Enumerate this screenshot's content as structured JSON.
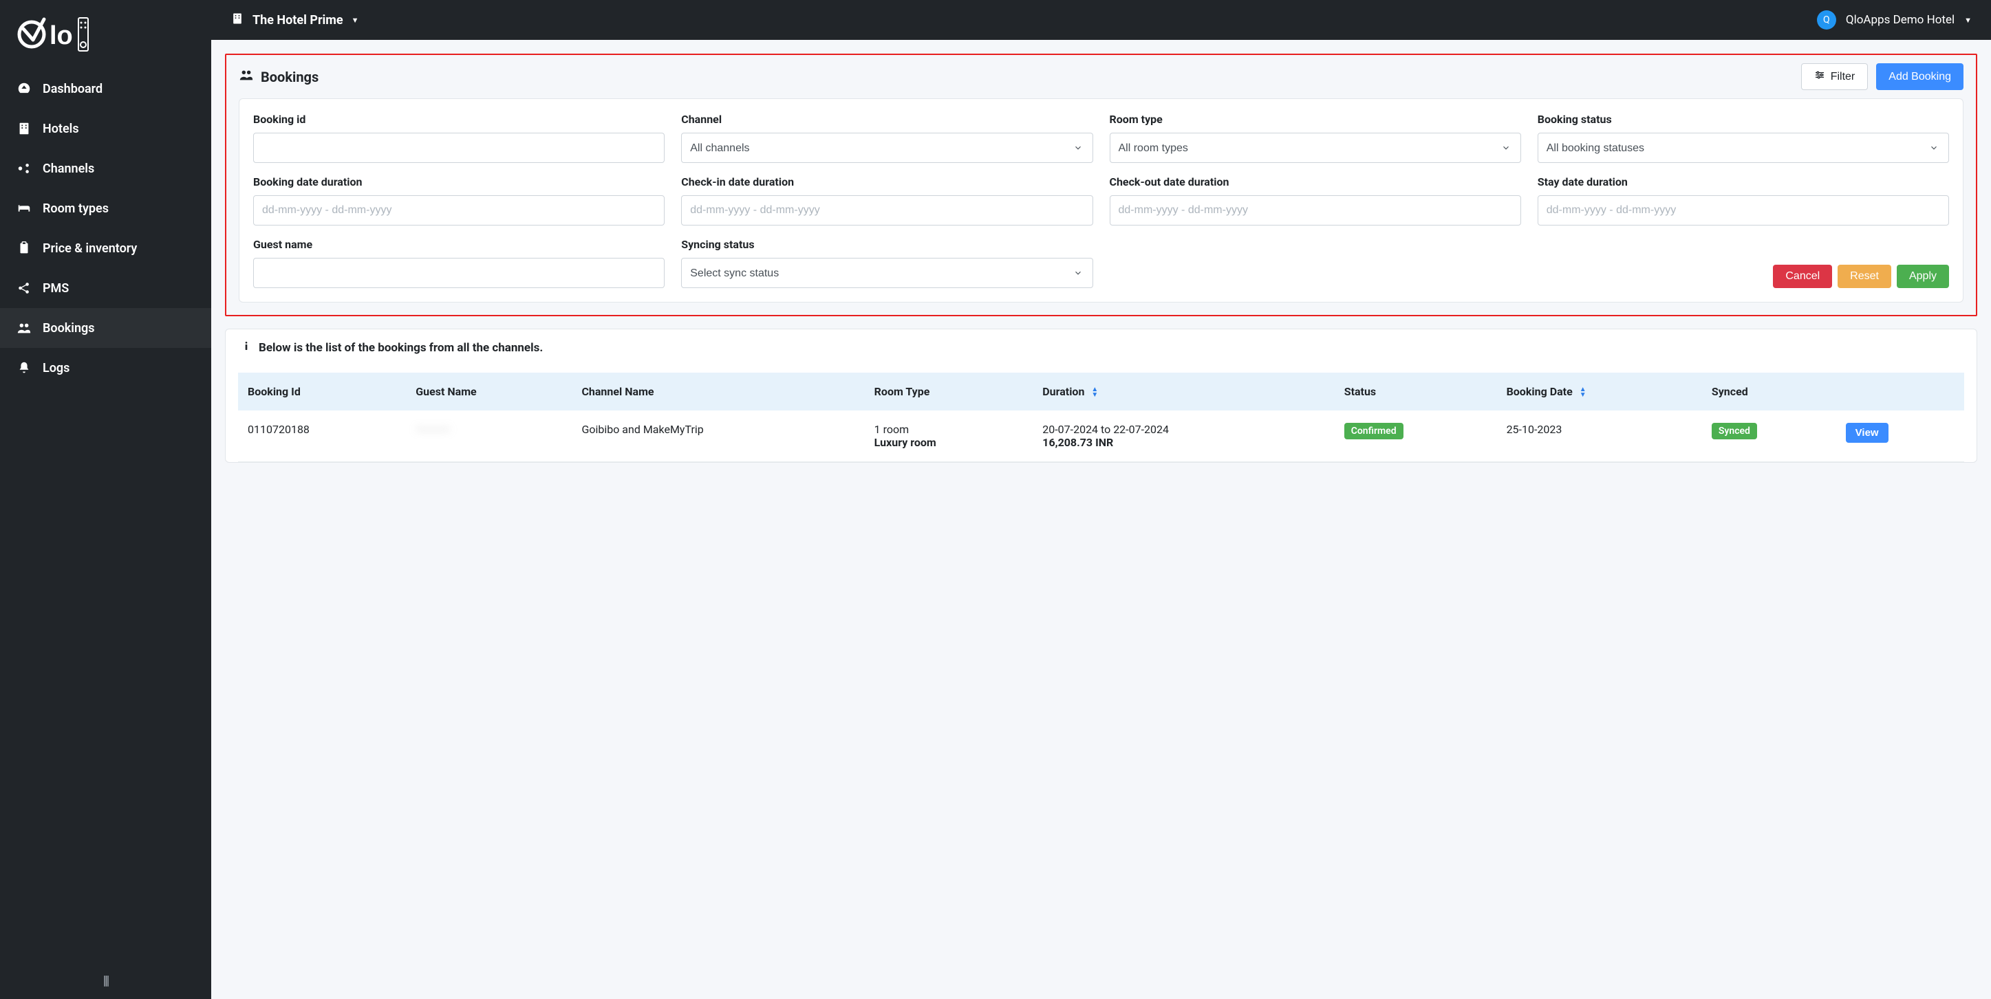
{
  "brand": {
    "avatar_initial": "Q"
  },
  "topbar": {
    "hotel_name": "The Hotel Prime",
    "user_name": "QloApps Demo Hotel"
  },
  "sidebar": {
    "items": [
      {
        "label": "Dashboard"
      },
      {
        "label": "Hotels"
      },
      {
        "label": "Channels"
      },
      {
        "label": "Room types"
      },
      {
        "label": "Price & inventory"
      },
      {
        "label": "PMS"
      },
      {
        "label": "Bookings"
      },
      {
        "label": "Logs"
      }
    ]
  },
  "page": {
    "title": "Bookings",
    "filter_button": "Filter",
    "add_button": "Add Booking"
  },
  "filters": {
    "booking_id_label": "Booking id",
    "channel_label": "Channel",
    "channel_value": "All channels",
    "room_type_label": "Room type",
    "room_type_value": "All room types",
    "booking_status_label": "Booking status",
    "booking_status_value": "All booking statuses",
    "booking_date_label": "Booking date duration",
    "checkin_date_label": "Check-in date duration",
    "checkout_date_label": "Check-out date duration",
    "stay_date_label": "Stay date duration",
    "date_placeholder": "dd-mm-yyyy - dd-mm-yyyy",
    "guest_name_label": "Guest name",
    "syncing_status_label": "Syncing status",
    "syncing_status_value": "Select sync status",
    "cancel": "Cancel",
    "reset": "Reset",
    "apply": "Apply"
  },
  "list": {
    "caption": "Below is the list of the bookings from all the channels.",
    "columns": {
      "booking_id": "Booking Id",
      "guest_name": "Guest Name",
      "channel_name": "Channel Name",
      "room_type": "Room Type",
      "duration": "Duration",
      "status": "Status",
      "booking_date": "Booking Date",
      "synced": "Synced",
      "actions": ""
    },
    "rows": [
      {
        "booking_id": "0110720188",
        "guest_name": "————",
        "channel_name": "Goibibo and MakeMyTrip",
        "room_qty": "1 room",
        "room_type": "Luxury room",
        "duration": "20-07-2024 to 22-07-2024",
        "price": "16,208.73 INR",
        "status": "Confirmed",
        "booking_date": "25-10-2023",
        "synced": "Synced",
        "view": "View"
      }
    ]
  }
}
